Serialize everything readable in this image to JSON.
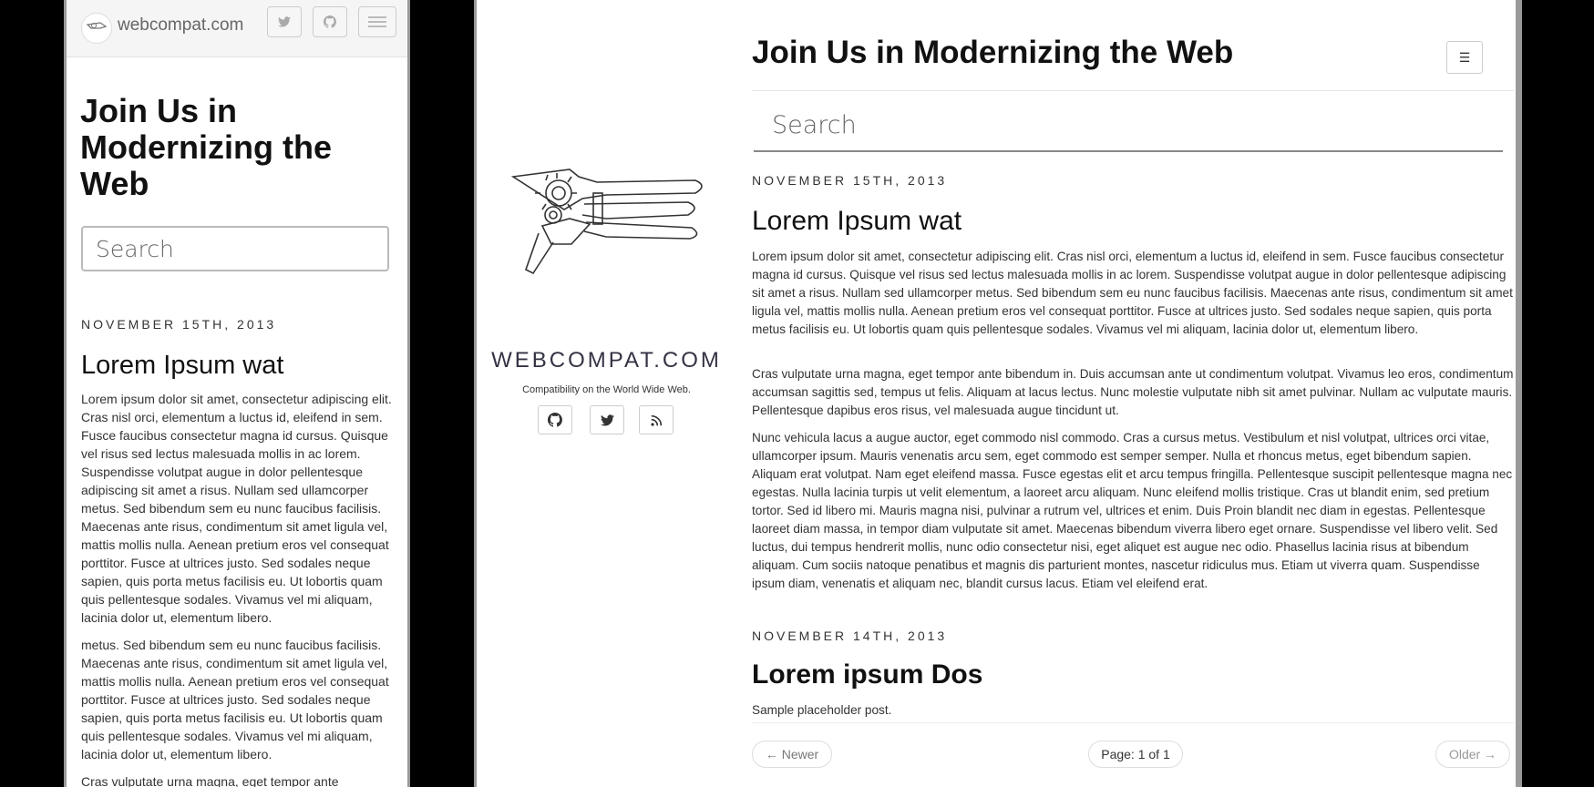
{
  "mobile": {
    "brand": "webcompat.com",
    "title": "Join Us in Modernizing the Web",
    "search_placeholder": "Search",
    "date": "NOVEMBER 15TH, 2013",
    "post_title": "Lorem Ipsum wat",
    "paragraphs": [
      "Lorem ipsum dolor sit amet, consectetur adipiscing elit. Cras nisl orci, elementum a luctus id, eleifend in sem. Fusce faucibus consectetur magna id cursus. Quisque vel risus sed lectus malesuada mollis in ac lorem. Suspendisse volutpat augue in dolor pellentesque adipiscing sit amet a risus. Nullam sed ullamcorper metus. Sed bibendum sem eu nunc faucibus facilisis. Maecenas ante risus, condimentum sit amet ligula vel, mattis mollis nulla. Aenean pretium eros vel consequat porttitor. Fusce at ultrices justo. Sed sodales neque sapien, quis porta metus facilisis eu. Ut lobortis quam quis pellentesque sodales. Vivamus vel mi aliquam, lacinia dolor ut, elementum libero.",
      "metus. Sed bibendum sem eu nunc faucibus facilisis. Maecenas ante risus, condimentum sit amet ligula vel, mattis mollis nulla. Aenean pretium eros vel consequat porttitor. Fusce at ultrices justo. Sed sodales neque sapien, quis porta metus facilisis eu. Ut lobortis quam quis pellentesque sodales. Vivamus vel mi aliquam, lacinia dolor ut, elementum libero.",
      "Cras vulputate urna magna, eget tempor ante"
    ]
  },
  "desktop": {
    "brand": "WEBCOMPAT.COM",
    "tagline": "Compatibility on the World Wide Web.",
    "title": "Join Us in Modernizing the Web",
    "search_placeholder": "Search",
    "menu_icon": "☰",
    "posts": [
      {
        "date": "NOVEMBER 15TH, 2013",
        "title": "Lorem Ipsum wat",
        "paragraphs": [
          "Lorem ipsum dolor sit amet, consectetur adipiscing elit. Cras nisl orci, elementum a luctus id, eleifend in sem. Fusce faucibus consectetur magna id cursus. Quisque vel risus sed lectus malesuada mollis in ac lorem. Suspendisse volutpat augue in dolor pellentesque adipiscing sit amet a risus. Nullam sed ullamcorper metus. Sed bibendum sem eu nunc faucibus facilisis. Maecenas ante risus, condimentum sit amet ligula vel, mattis mollis nulla. Aenean pretium eros vel consequat porttitor. Fusce at ultrices justo. Sed sodales neque sapien, quis porta metus facilisis eu. Ut lobortis quam quis pellentesque sodales. Vivamus vel mi aliquam, lacinia dolor ut, elementum libero.",
          "Cras vulputate urna magna, eget tempor ante bibendum in. Duis accumsan ante ut condimentum volutpat. Vivamus leo eros, condimentum accumsan sagittis sed, tempus ut felis. Aliquam at lacus lectus. Nunc molestie vulputate nibh sit amet pulvinar. Nullam ac vulputate mauris. Pellentesque dapibus eros risus, vel malesuada augue tincidunt ut.",
          "Nunc vehicula lacus a augue auctor, eget commodo nisl commodo. Cras a cursus metus. Vestibulum et nisl volutpat, ultrices orci vitae, ullamcorper ipsum. Mauris venenatis arcu sem, eget commodo est semper semper. Nulla et rhoncus metus, eget bibendum sapien. Aliquam erat volutpat. Nam eget eleifend massa. Fusce egestas elit et arcu tempus fringilla. Pellentesque suscipit pellentesque magna nec egestas. Nulla lacinia turpis ut velit elementum, a laoreet arcu aliquam. Nunc eleifend mollis tristique. Cras ut blandit enim, sed pretium tortor. Sed id libero mi. Mauris magna nisi, pulvinar a rutrum vel, ultrices et enim. Duis Proin blandit nec diam in egestas. Pellentesque laoreet diam massa, in tempor diam vulputate sit amet. Maecenas bibendum viverra libero eget ornare. Suspendisse vel libero velit. Sed luctus, dui tempus hendrerit mollis, nunc odio consectetur nisi, eget aliquet est augue nec odio. Phasellus lacinia risus at bibendum aliquam. Cum sociis natoque penatibus et magnis dis parturient montes, nascetur ridiculus mus. Etiam ut viverra quam. Suspendisse ipsum diam, venenatis et aliquam nec, blandit cursus lacus. Etiam vel eleifend erat."
        ]
      },
      {
        "date": "NOVEMBER 14TH, 2013",
        "title": "Lorem ipsum Dos",
        "body": "Sample placeholder post."
      }
    ],
    "pagination": {
      "newer": "← Newer",
      "page": "Page: 1 of 1",
      "older": "Older →"
    }
  }
}
